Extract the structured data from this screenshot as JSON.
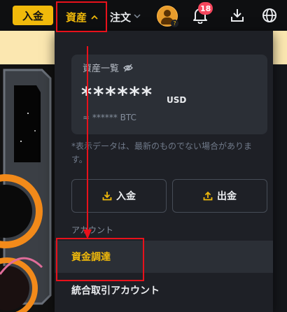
{
  "topbar": {
    "deposit_label": "入金",
    "assets_label": "資産",
    "orders_label": "注文",
    "notification_count": "18"
  },
  "dropdown": {
    "overview_title": "資産一覧",
    "balance_masked": "******",
    "balance_currency": "USD",
    "btc_masked": "≈ ****** BTC",
    "note": "*表示データは、最新のものでない場合があります。",
    "deposit_button": "入金",
    "withdraw_button": "出金",
    "account_section": "アカウント",
    "items": [
      {
        "label": "資金調達"
      },
      {
        "label": "統合取引アカウント"
      }
    ]
  },
  "colors": {
    "accent": "#f0b90b",
    "panel": "#1e2026",
    "card": "#2b2f36",
    "badge": "#f6465d",
    "annotation": "#e8111b"
  },
  "icons": [
    "chevron-up-icon",
    "chevron-down-icon",
    "avatar",
    "bell-icon",
    "download-icon",
    "globe-icon",
    "eye-off-icon",
    "deposit-icon",
    "withdraw-icon"
  ]
}
